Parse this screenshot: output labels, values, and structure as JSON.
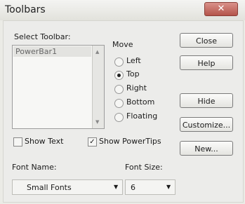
{
  "window": {
    "title": "Toolbars",
    "close_glyph": "✕"
  },
  "toolbar_list": {
    "label": "Select Toolbar:",
    "items": [
      "PowerBar1"
    ],
    "selected": "PowerBar1"
  },
  "move": {
    "label": "Move",
    "options": [
      "Left",
      "Top",
      "Right",
      "Bottom",
      "Floating"
    ],
    "selected": "Top"
  },
  "buttons": {
    "close": "Close",
    "help": "Help",
    "hide": "Hide",
    "customize": "Customize...",
    "new": "New..."
  },
  "show_text": {
    "label": "Show Text",
    "checked": false
  },
  "show_powertips": {
    "label": "Show PowerTips",
    "checked": true
  },
  "font_name": {
    "label": "Font Name:",
    "value": "Small Fonts"
  },
  "font_size": {
    "label": "Font Size:",
    "value": "6"
  }
}
